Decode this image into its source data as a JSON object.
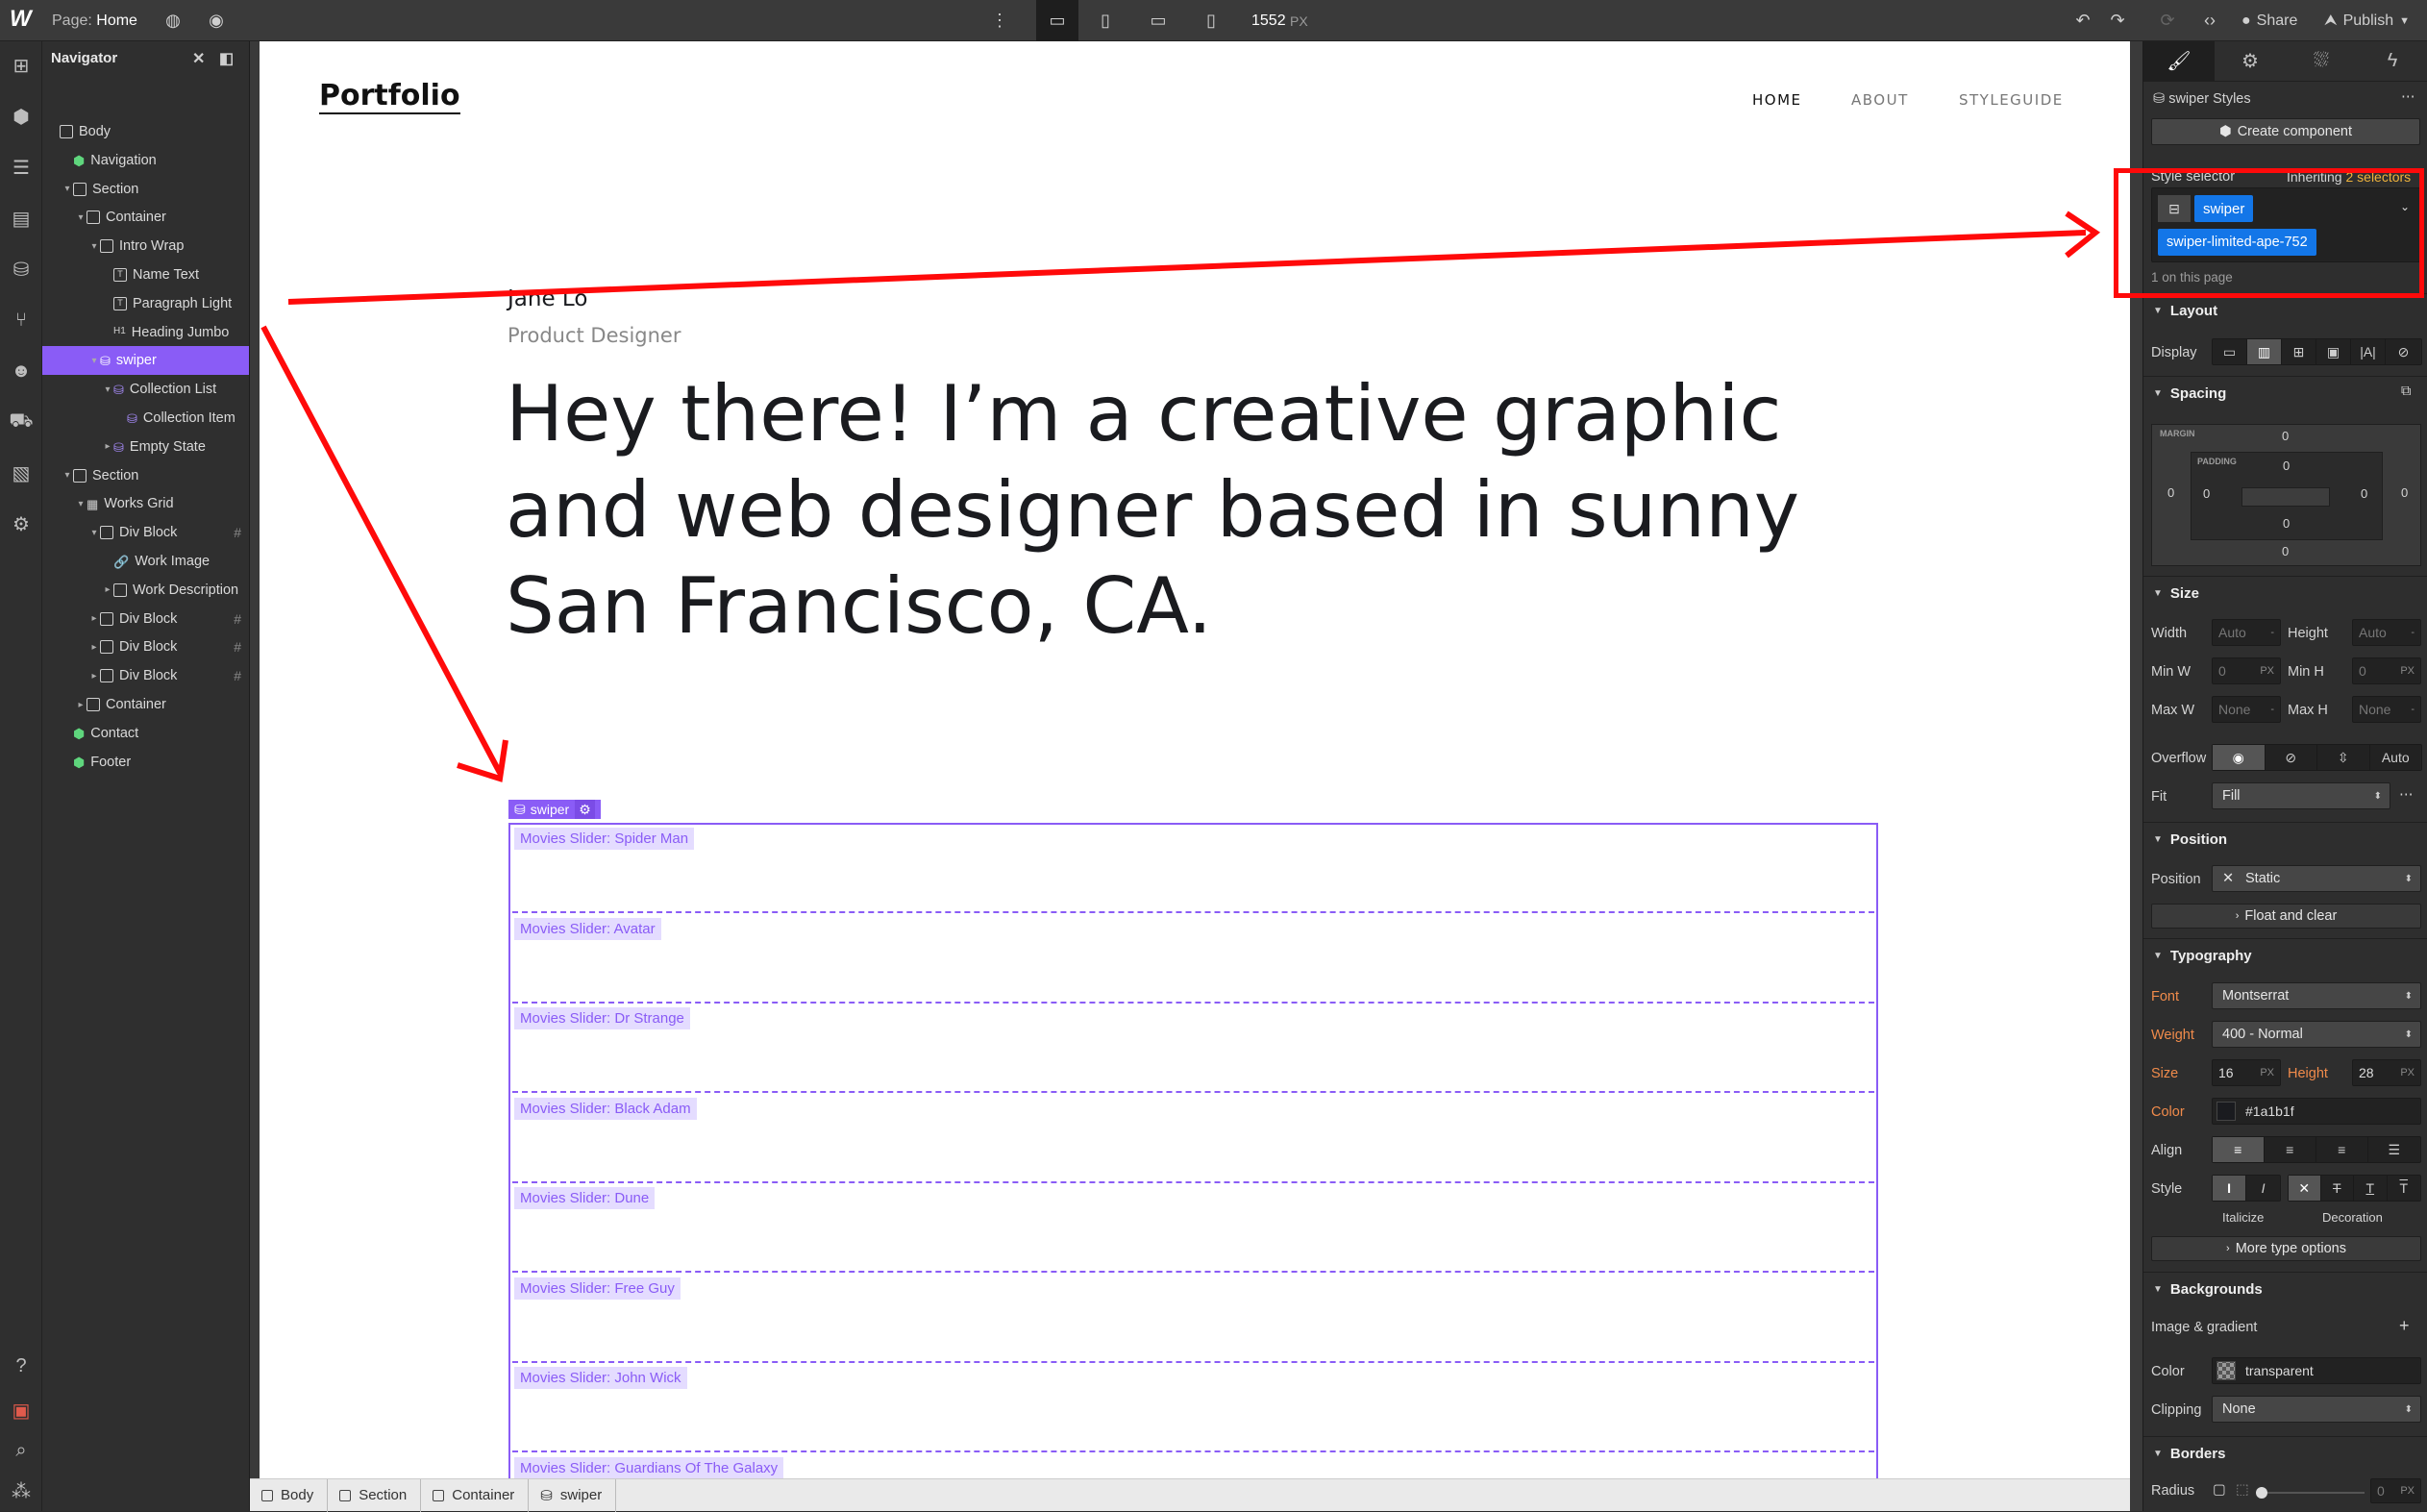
{
  "topbar": {
    "page_prefix": "Page:",
    "page_name": "Home",
    "canvas_width": "1552",
    "canvas_unit": "PX",
    "share": "Share",
    "publish": "Publish"
  },
  "navigator": {
    "title": "Navigator",
    "items": [
      {
        "label": "Body"
      },
      {
        "label": "Navigation"
      },
      {
        "label": "Section"
      },
      {
        "label": "Container"
      },
      {
        "label": "Intro Wrap"
      },
      {
        "label": "Name Text"
      },
      {
        "label": "Paragraph Light"
      },
      {
        "label": "Heading Jumbo"
      },
      {
        "label": "swiper"
      },
      {
        "label": "Collection List"
      },
      {
        "label": "Collection Item"
      },
      {
        "label": "Empty State"
      },
      {
        "label": "Section"
      },
      {
        "label": "Works Grid"
      },
      {
        "label": "Div Block"
      },
      {
        "label": "Work Image"
      },
      {
        "label": "Work Description"
      },
      {
        "label": "Div Block"
      },
      {
        "label": "Div Block"
      },
      {
        "label": "Div Block"
      },
      {
        "label": "Container"
      },
      {
        "label": "Contact"
      },
      {
        "label": "Footer"
      }
    ]
  },
  "site": {
    "logo": "Portfolio",
    "nav": [
      "HOME",
      "ABOUT",
      "STYLEGUIDE"
    ],
    "name": "Jane Lo",
    "role": "Product Designer",
    "headline": "Hey there! I’m a creative graphic and web designer based in sunny San Francisco, CA.",
    "swiper_tag": "swiper",
    "slides": [
      "Movies Slider: Spider Man",
      "Movies Slider: Avatar",
      "Movies Slider: Dr Strange",
      "Movies Slider: Black Adam",
      "Movies Slider: Dune",
      "Movies Slider: Free Guy",
      "Movies Slider: John Wick",
      "Movies Slider: Guardians Of The Galaxy"
    ]
  },
  "breadcrumb": [
    "Body",
    "Section",
    "Container",
    "swiper"
  ],
  "panel": {
    "styles_title": "swiper Styles",
    "create_component": "Create component",
    "style_selector": "Style selector",
    "inheriting_prefix": "Inheriting",
    "inheriting_count": "2 selectors",
    "chip_primary": "swiper",
    "chip_combo": "swiper-limited-ape-752",
    "on_page": "1 on this page",
    "layout": {
      "title": "Layout",
      "display": "Display"
    },
    "spacing": {
      "title": "Spacing",
      "margin": "MARGIN",
      "padding": "PADDING",
      "margin_top": "0",
      "margin_right": "0",
      "margin_bottom": "0",
      "margin_left": "0",
      "padding_top": "0",
      "padding_right": "0",
      "padding_bottom": "0",
      "padding_left": "0"
    },
    "size": {
      "title": "Size",
      "width": "Width",
      "height": "Height",
      "min_w": "Min W",
      "min_h": "Min H",
      "max_w": "Max W",
      "max_h": "Max H",
      "width_val": "Auto",
      "height_val": "Auto",
      "min_w_val": "0",
      "min_h_val": "0",
      "max_w_val": "None",
      "max_h_val": "None",
      "unit_dash": "-",
      "unit_px": "PX",
      "overflow": "Overflow",
      "overflow_auto": "Auto",
      "fit": "Fit",
      "fit_val": "Fill"
    },
    "position": {
      "title": "Position",
      "label": "Position",
      "value": "Static",
      "float": "Float and clear"
    },
    "typography": {
      "title": "Typography",
      "font": "Font",
      "font_val": "Montserrat",
      "weight": "Weight",
      "weight_val": "400 - Normal",
      "size": "Size",
      "size_val": "16",
      "size_unit": "PX",
      "height": "Height",
      "height_val": "28",
      "height_unit": "PX",
      "color": "Color",
      "color_val": "#1a1b1f",
      "align": "Align",
      "style": "Style",
      "italicize": "Italicize",
      "decoration": "Decoration",
      "more": "More type options"
    },
    "backgrounds": {
      "title": "Backgrounds",
      "image": "Image & gradient",
      "color": "Color",
      "color_val": "transparent",
      "clipping": "Clipping",
      "clipping_val": "None"
    },
    "borders": {
      "title": "Borders",
      "radius": "Radius",
      "radius_val": "0",
      "radius_unit": "PX"
    }
  }
}
